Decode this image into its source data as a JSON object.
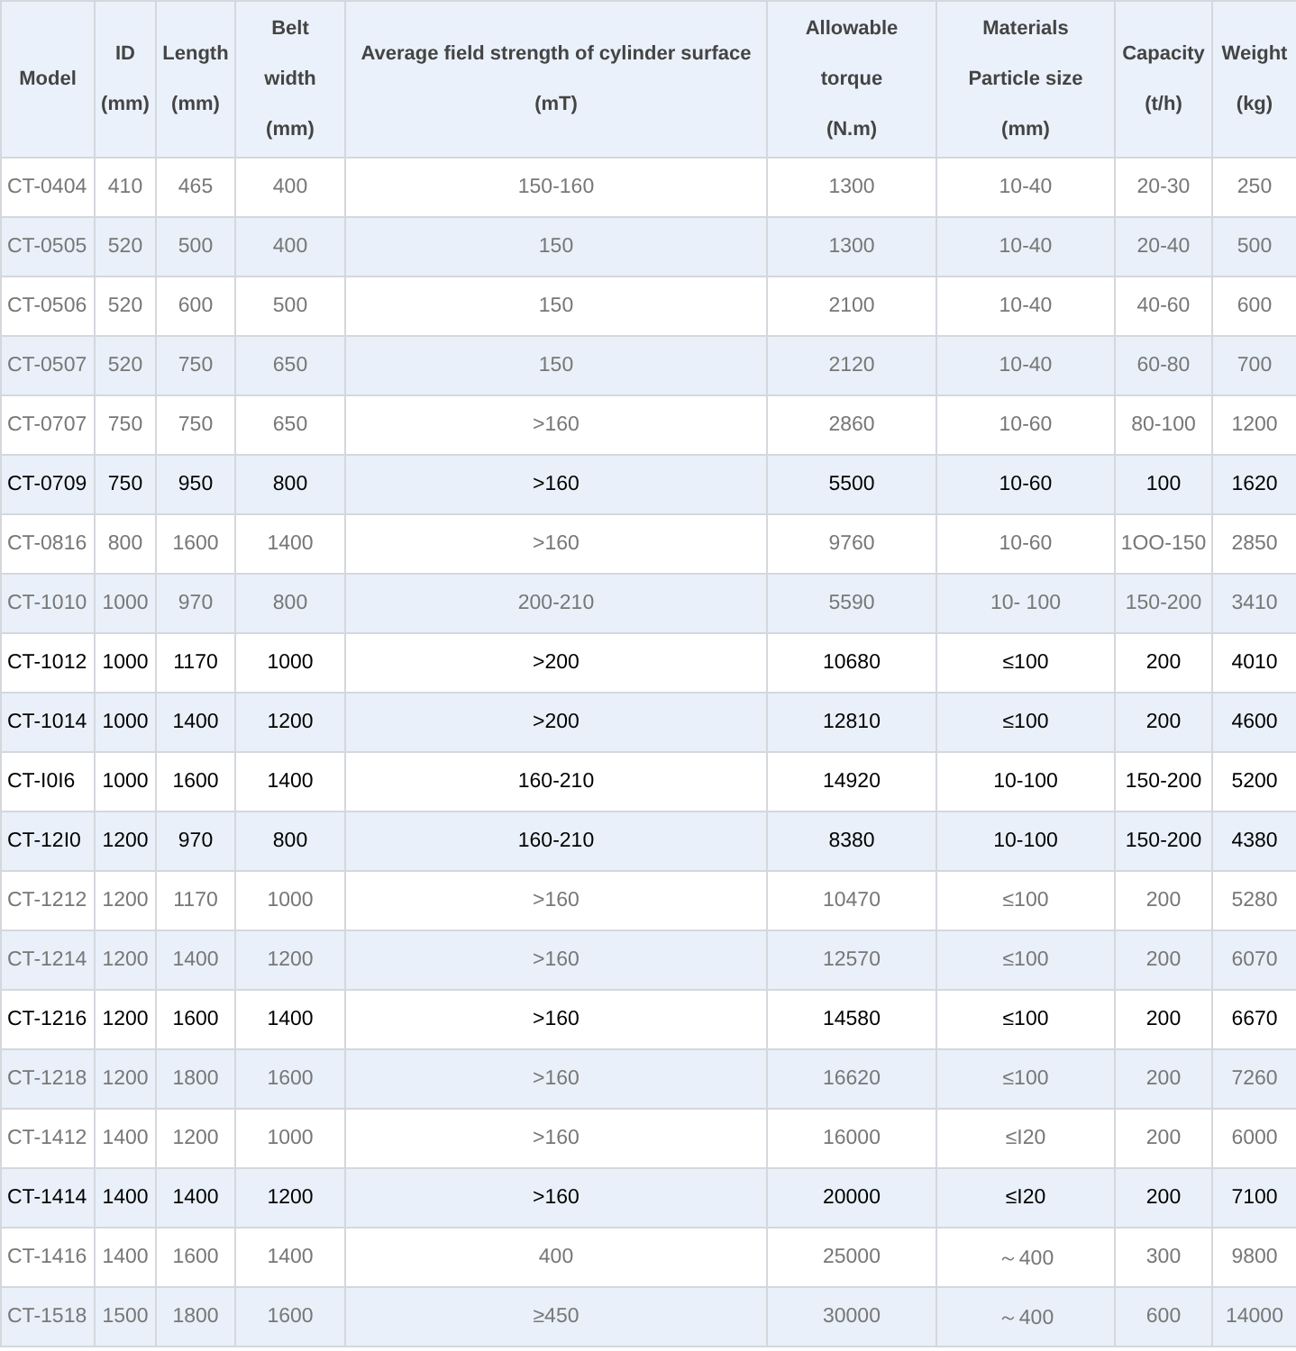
{
  "table": {
    "columns": [
      {
        "lines": [
          "Model"
        ]
      },
      {
        "lines": [
          "ID",
          "(mm)"
        ]
      },
      {
        "lines": [
          "Length",
          "(mm)"
        ]
      },
      {
        "lines": [
          "Belt",
          "width",
          "(mm)"
        ]
      },
      {
        "lines": [
          "Average field strength of cylinder surface",
          "(mT)"
        ]
      },
      {
        "lines": [
          "Allowable",
          "torque",
          "(N.m)"
        ]
      },
      {
        "lines": [
          "Materials",
          "Particle size",
          "(mm)"
        ]
      },
      {
        "lines": [
          "Capacity",
          "(t/h)"
        ]
      },
      {
        "lines": [
          "Weight",
          "(kg)"
        ]
      }
    ],
    "rows": [
      {
        "emphasized": false,
        "cells": [
          "CT-0404",
          "410",
          "465",
          "400",
          "150-160",
          "1300",
          "10-40",
          "20-30",
          "250"
        ]
      },
      {
        "emphasized": false,
        "cells": [
          "CT-0505",
          "520",
          "500",
          "400",
          "150",
          "1300",
          "10-40",
          "20-40",
          "500"
        ]
      },
      {
        "emphasized": false,
        "cells": [
          "CT-0506",
          "520",
          "600",
          "500",
          "150",
          "2100",
          "10-40",
          "40-60",
          "600"
        ]
      },
      {
        "emphasized": false,
        "cells": [
          "CT-0507",
          "520",
          "750",
          "650",
          "150",
          "2120",
          "10-40",
          "60-80",
          "700"
        ]
      },
      {
        "emphasized": false,
        "cells": [
          "CT-0707",
          "750",
          "750",
          "650",
          ">160",
          "2860",
          "10-60",
          "80-100",
          "1200"
        ]
      },
      {
        "emphasized": true,
        "cells": [
          "CT-0709",
          "750",
          "950",
          "800",
          ">160",
          "5500",
          "10-60",
          "100",
          "1620"
        ]
      },
      {
        "emphasized": false,
        "cells": [
          "CT-0816",
          "800",
          "1600",
          "1400",
          ">160",
          "9760",
          "10-60",
          "1OO-150",
          "2850"
        ]
      },
      {
        "emphasized": false,
        "cells": [
          "CT-1010",
          "1000",
          "970",
          "800",
          "200-210",
          "5590",
          "10- 100",
          "150-200",
          "3410"
        ]
      },
      {
        "emphasized": true,
        "cells": [
          "CT-1012",
          "1000",
          "1170",
          "1000",
          ">200",
          "10680",
          "≤100",
          "200",
          "4010"
        ]
      },
      {
        "emphasized": true,
        "cells": [
          "CT-1014",
          "1000",
          "1400",
          "1200",
          ">200",
          "12810",
          "≤100",
          "200",
          "4600"
        ]
      },
      {
        "emphasized": true,
        "cells": [
          "CT-I0I6",
          "1000",
          "1600",
          "1400",
          "160-210",
          "14920",
          "10-100",
          "150-200",
          "5200"
        ]
      },
      {
        "emphasized": true,
        "cells": [
          "CT-12I0",
          "1200",
          "970",
          "800",
          "160-210",
          "8380",
          "10-100",
          "150-200",
          "4380"
        ]
      },
      {
        "emphasized": false,
        "cells": [
          "CT-1212",
          "1200",
          "1170",
          "1000",
          ">160",
          "10470",
          "≤100",
          "200",
          "5280"
        ]
      },
      {
        "emphasized": false,
        "cells": [
          "CT-1214",
          "1200",
          "1400",
          "1200",
          ">160",
          "12570",
          "≤100",
          "200",
          "6070"
        ]
      },
      {
        "emphasized": true,
        "cells": [
          "CT-1216",
          "1200",
          "1600",
          "1400",
          ">160",
          "14580",
          "≤100",
          "200",
          "6670"
        ]
      },
      {
        "emphasized": false,
        "cells": [
          "CT-1218",
          "1200",
          "1800",
          "1600",
          ">160",
          "16620",
          "≤100",
          "200",
          "7260"
        ]
      },
      {
        "emphasized": false,
        "cells": [
          "CT-1412",
          "1400",
          "1200",
          "1000",
          ">160",
          "16000",
          "≤I20",
          "200",
          "6000"
        ]
      },
      {
        "emphasized": true,
        "cells": [
          "CT-1414",
          "1400",
          "1400",
          "1200",
          ">160",
          "20000",
          "≤I20",
          "200",
          "7100"
        ]
      },
      {
        "emphasized": false,
        "cells": [
          "CT-1416",
          "1400",
          "1600",
          "1400",
          "400",
          "25000",
          "～400",
          "300",
          "9800"
        ]
      },
      {
        "emphasized": false,
        "cells": [
          "CT-1518",
          "1500",
          "1800",
          "1600",
          "≥450",
          "30000",
          "～400",
          "600",
          "14000"
        ]
      }
    ]
  }
}
